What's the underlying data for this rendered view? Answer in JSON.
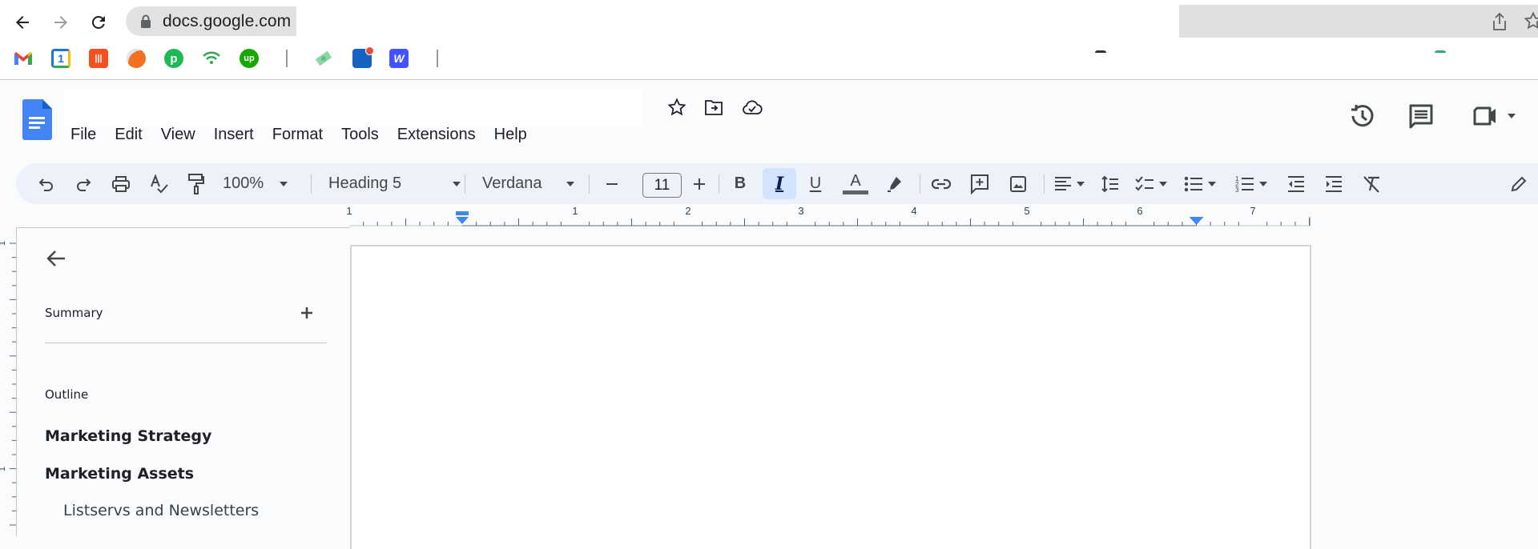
{
  "browser": {
    "url": "docs.google.com",
    "nav": {
      "back": "back-icon",
      "forward": "forward-icon",
      "reload": "reload-icon"
    },
    "bookmarks": [
      {
        "name": "gmail",
        "color": "#ea4335",
        "glyph": "M"
      },
      {
        "name": "google-calendar",
        "color": "#1a73e8",
        "glyph": "1"
      },
      {
        "name": "bookmark-orange-bars",
        "color": "#f4511e",
        "glyph": "|||"
      },
      {
        "name": "bookmark-orange-circle",
        "color": "#f37021",
        "glyph": ""
      },
      {
        "name": "bookmark-green-p",
        "color": "#1db954",
        "glyph": "p"
      },
      {
        "name": "bookmark-wifi",
        "color": "#34a853",
        "glyph": ""
      },
      {
        "name": "upwork",
        "color": "#14a800",
        "glyph": "up"
      },
      {
        "name": "bookmark-money",
        "color": "#7fcf9f",
        "glyph": ""
      },
      {
        "name": "bookmark-blue-badge",
        "color": "#1565c0",
        "glyph": ""
      },
      {
        "name": "webflow",
        "color": "#4353ff",
        "glyph": "W"
      }
    ]
  },
  "docs": {
    "title": "",
    "menu": [
      "File",
      "Edit",
      "View",
      "Insert",
      "Format",
      "Tools",
      "Extensions",
      "Help"
    ],
    "header_icons": [
      "star-icon",
      "move-to-folder-icon",
      "cloud-saved-icon"
    ],
    "right_icons": [
      "version-history-icon",
      "comments-icon",
      "meet-icon"
    ]
  },
  "toolbar": {
    "zoom": "100%",
    "style": "Heading 5",
    "font": "Verdana",
    "font_size": "11",
    "italic_active": true,
    "text_color": "#5f6368",
    "accent": "#d3e3fd"
  },
  "ruler": {
    "labels": [
      "1",
      "1",
      "2",
      "3",
      "4",
      "5",
      "6",
      "7"
    ],
    "marker_color": "#4285f4"
  },
  "sidepanel": {
    "summary_label": "Summary",
    "outline_label": "Outline",
    "outline_items": [
      {
        "text": "Marketing Strategy",
        "level": 1
      },
      {
        "text": "Marketing Assets",
        "level": 1
      },
      {
        "text": "Listservs and Newsletters",
        "level": 2
      }
    ]
  }
}
